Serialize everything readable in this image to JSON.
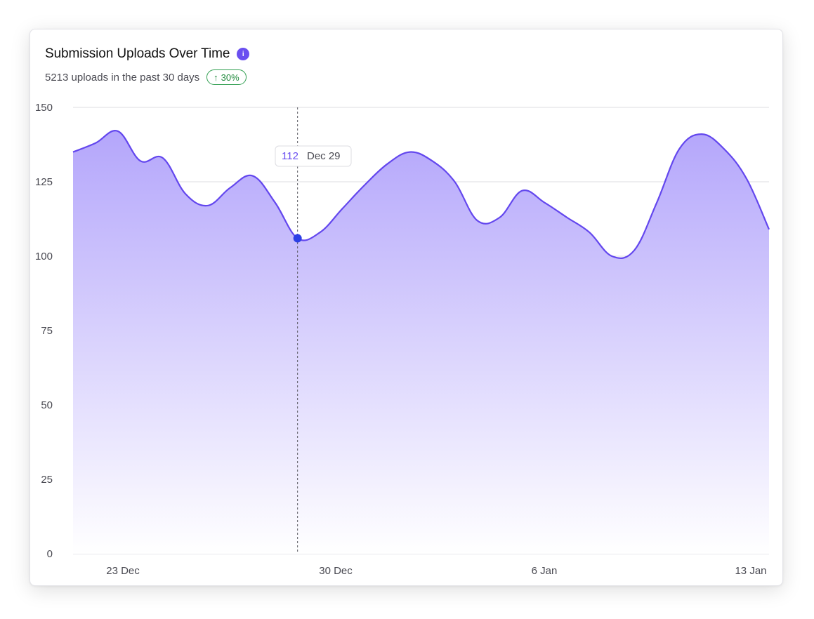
{
  "card": {
    "title": "Submission Uploads Over Time",
    "info_icon": "info-icon",
    "subtitle": "5213 uploads in the past 30 days",
    "badge": {
      "arrow": "↑",
      "text": "30%",
      "icon": "arrow-up-icon"
    }
  },
  "tooltip": {
    "value": "112",
    "date": "Dec 29"
  },
  "colors": {
    "accent": "#6a4ff0",
    "line": "#6347ee",
    "fill_top": "#b4a6fb",
    "fill_bottom": "#ffffff",
    "point": "#2c3fe6",
    "info": "#6a4ff0",
    "badge_text": "#1f8a3c",
    "badge_border": "#2f9e4f",
    "badge_bg": "#ffffff",
    "grid": "#dcdce2",
    "crosshair": "#55555c"
  },
  "chart_data": {
    "type": "area",
    "x_axis_type": "date",
    "x": [
      "2024-12-21",
      "2024-12-22",
      "2024-12-23",
      "2024-12-24",
      "2024-12-25",
      "2024-12-26",
      "2024-12-27",
      "2024-12-28",
      "2024-12-29",
      "2024-12-30",
      "2024-12-31",
      "2025-01-01",
      "2025-01-02",
      "2025-01-03",
      "2025-01-04",
      "2025-01-05",
      "2025-01-06",
      "2025-01-07",
      "2025-01-08",
      "2025-01-09",
      "2025-01-10",
      "2025-01-11",
      "2025-01-12",
      "2025-01-13",
      "2025-01-14"
    ],
    "y": [
      135,
      138,
      142,
      132,
      133,
      121,
      117,
      123,
      127,
      118,
      106,
      108,
      116,
      124,
      131,
      135,
      132,
      125,
      112,
      113,
      122,
      118,
      113,
      108,
      100,
      102,
      118,
      136,
      141,
      136,
      126,
      109
    ],
    "xticks": [
      "23 Dec",
      "30 Dec",
      "6 Jan",
      "13 Jan"
    ],
    "yticks": [
      0,
      25,
      50,
      75,
      100,
      125,
      150
    ],
    "ylim": [
      0,
      150
    ],
    "title": "",
    "xlabel": "",
    "ylabel": "",
    "grid": true,
    "highlight": {
      "date": "Dec 29",
      "value": 112
    }
  }
}
